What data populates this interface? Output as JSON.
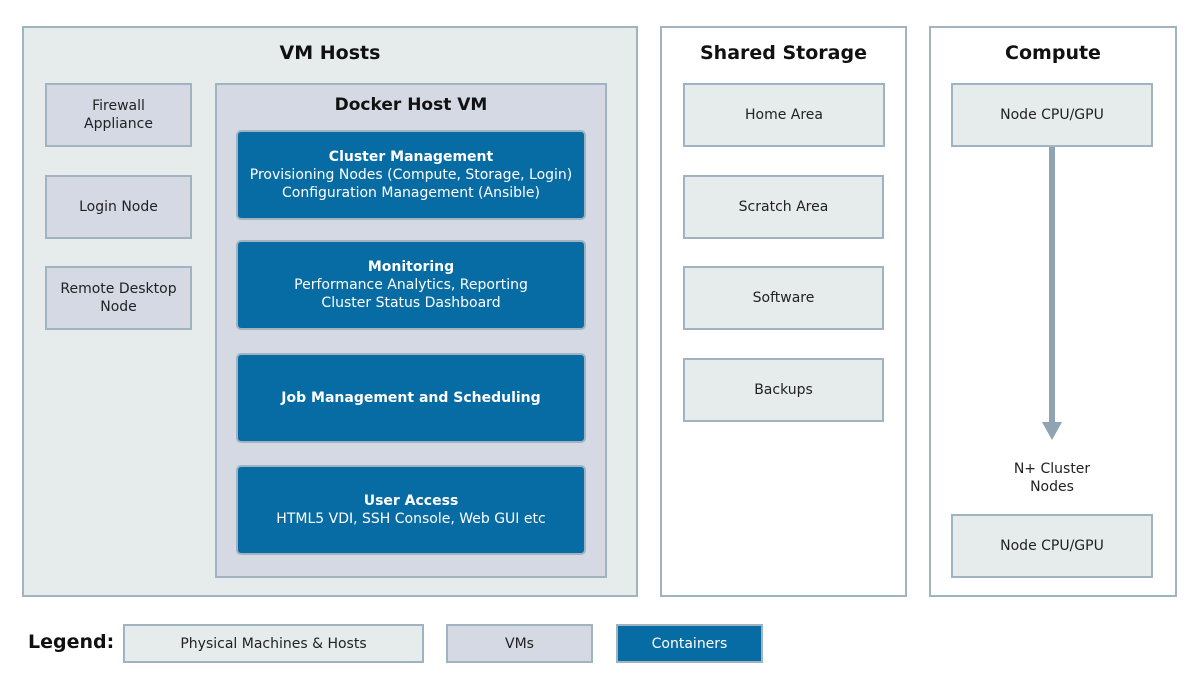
{
  "vm_hosts": {
    "title": "VM Hosts",
    "left_boxes": [
      {
        "label": "Firewall\nAppliance",
        "lines": [
          "Firewall",
          "Appliance"
        ]
      },
      {
        "label": "Login Node",
        "lines": [
          "Login Node"
        ]
      },
      {
        "label": "Remote Desktop\nNode",
        "lines": [
          "Remote Desktop",
          "Node"
        ]
      }
    ],
    "docker_host": {
      "title": "Docker Host VM",
      "containers": [
        {
          "title": "Cluster Management",
          "lines": [
            "Provisioning Nodes (Compute, Storage, Login)",
            "Configuration Management (Ansible)"
          ]
        },
        {
          "title": "Monitoring",
          "lines": [
            "Performance Analytics, Reporting",
            "Cluster Status Dashboard"
          ]
        },
        {
          "title": "Job Management and Scheduling",
          "lines": []
        },
        {
          "title": "User Access",
          "lines": [
            "HTML5 VDI, SSH Console, Web GUI etc"
          ]
        }
      ]
    }
  },
  "shared_storage": {
    "title": "Shared Storage",
    "boxes": [
      "Home Area",
      "Scratch Area",
      "Software",
      "Backups"
    ]
  },
  "compute": {
    "title": "Compute",
    "top_node": "Node CPU/GPU",
    "arrow_label": [
      "N+ Cluster",
      "Nodes"
    ],
    "bottom_node": "Node CPU/GPU"
  },
  "legend": {
    "label": "Legend:",
    "items": [
      {
        "label": "Physical Machines & Hosts",
        "color": "#e6ebeb"
      },
      {
        "label": "VMs",
        "color": "#d4d9e4"
      },
      {
        "label": "Containers",
        "color": "#086ca4"
      }
    ]
  },
  "colors": {
    "physical": "#e6ebeb",
    "vm": "#d4d9e4",
    "container": "#086ca4",
    "border": "#9fb3c0",
    "arrow": "#8ea4b3"
  }
}
